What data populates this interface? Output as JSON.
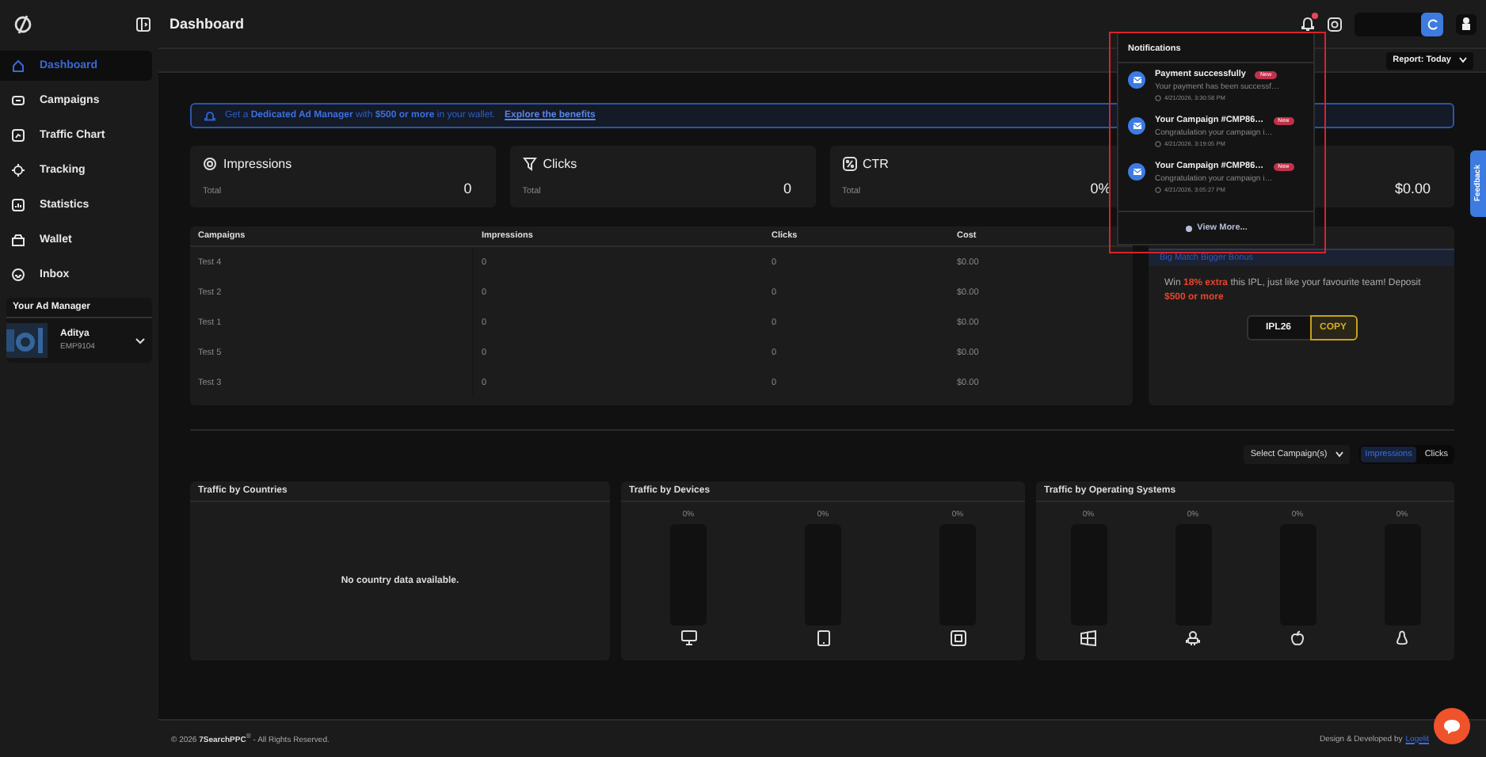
{
  "sidebar": {
    "items": [
      {
        "label": "Dashboard",
        "selected": true
      },
      {
        "label": "Campaigns",
        "selected": false
      },
      {
        "label": "Traffic Chart",
        "selected": false
      },
      {
        "label": "Tracking",
        "selected": false
      },
      {
        "label": "Statistics",
        "selected": false
      },
      {
        "label": "Wallet",
        "selected": false
      },
      {
        "label": "Inbox",
        "selected": false
      }
    ],
    "ad_manager": {
      "title": "Your Ad Manager",
      "name": "Aditya",
      "id": "EMP9104"
    }
  },
  "header": {
    "title": "Dashboard",
    "unread": true
  },
  "report_select": "Report: Today",
  "banner": {
    "text": "Get a **Dedicated Ad Manager** with **$500 or more** in your wallet.",
    "link": "Explore the benefits"
  },
  "stats": [
    {
      "label": "Impressions",
      "sub": "Total",
      "value": "0"
    },
    {
      "label": "Clicks",
      "sub": "Total",
      "value": "0"
    },
    {
      "label": "CTR",
      "sub": "Total",
      "value": "0%"
    },
    {
      "value": "$0.00"
    }
  ],
  "table": {
    "columns": [
      "Campaigns",
      "Impressions",
      "Clicks",
      "Cost"
    ],
    "rows": [
      [
        "Test 4",
        "0",
        "0",
        "$0.00"
      ],
      [
        "Test 2",
        "0",
        "0",
        "$0.00"
      ],
      [
        "Test 1",
        "0",
        "0",
        "$0.00"
      ],
      [
        "Test 5",
        "0",
        "0",
        "$0.00"
      ],
      [
        "Test 3",
        "0",
        "0",
        "$0.00"
      ]
    ]
  },
  "promo": {
    "title": "Big Match Bigger Bonus",
    "text": "Win **18% extra** this IPL, just like your favourite team! Deposit **$500 or more**",
    "code": "IPL26",
    "button": "COPY"
  },
  "notifications": {
    "title": "Notifications",
    "items": [
      {
        "title": "Payment successfully",
        "badge": "New",
        "message": "Your payment has been successf…",
        "time": "4/21/2026, 3:30:58 PM"
      },
      {
        "title": "Your Campaign #CMP86…",
        "badge": "New",
        "message": "Congratulation your campaign i…",
        "time": "4/21/2026, 3:19:05 PM"
      },
      {
        "title": "Your Campaign #CMP86…",
        "badge": "New",
        "message": "Congratulation your campaign i…",
        "time": "4/21/2026, 3:05:27 PM"
      }
    ],
    "more": "View More..."
  },
  "controls": {
    "campaign_select": "Select Campaign(s)",
    "toggle": [
      {
        "label": "Impressions",
        "selected": true
      },
      {
        "label": "Clicks",
        "selected": false
      }
    ]
  },
  "countries": {
    "title": "Traffic by Countries",
    "empty": "No country data available."
  },
  "devices": {
    "title": "Traffic by Devices",
    "bars": [
      {
        "reading": "0%",
        "level": 0
      },
      {
        "reading": "0%",
        "level": 0
      },
      {
        "reading": "0%",
        "level": 0
      }
    ]
  },
  "operating_systems": {
    "title": "Traffic by Operating Systems",
    "bars": [
      {
        "reading": "0%",
        "level": 0
      },
      {
        "reading": "0%",
        "level": 0
      },
      {
        "reading": "0%",
        "level": 0
      },
      {
        "reading": "0%",
        "level": 0
      }
    ]
  },
  "feedback": "Feedback",
  "footer": {
    "copyright": "© 2026 **7SearchPPC**$^{®}$ - All Rights Reserved.",
    "credit": "Design & Developed by",
    "link": "Logelit"
  }
}
